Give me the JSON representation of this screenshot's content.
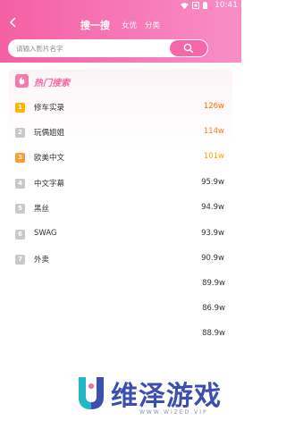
{
  "status": {
    "time": "10:41",
    "icons": [
      "wifi-icon",
      "battery-saver-icon",
      "battery-icon"
    ]
  },
  "header": {
    "back_icon": "chevron-left-icon",
    "tabs": [
      {
        "label": "搜一搜",
        "active": true
      },
      {
        "label": "女优",
        "active": false
      },
      {
        "label": "分类",
        "active": false
      }
    ]
  },
  "search": {
    "placeholder": "请输入影片名字",
    "button_icon": "search-icon"
  },
  "hot": {
    "title": "热门搜索",
    "items": [
      {
        "rank": "1",
        "name": "修车实录",
        "count": "126w"
      },
      {
        "rank": "2",
        "name": "玩偶姐姐",
        "count": "114w"
      },
      {
        "rank": "3",
        "name": "欧美中文",
        "count": "101w"
      },
      {
        "rank": "4",
        "name": "中文字幕",
        "count": "95.9w"
      },
      {
        "rank": "5",
        "name": "黑丝",
        "count": "94.9w"
      },
      {
        "rank": "6",
        "name": "SWAG",
        "count": "93.9w"
      },
      {
        "rank": "7",
        "name": "外卖",
        "count": "90.9w"
      }
    ],
    "extra_counts": [
      "89.9w",
      "86.9w",
      "88.9w"
    ]
  },
  "watermark": {
    "text": "维泽游戏",
    "sub": "WWW.WIZED.VIP"
  },
  "colors": {
    "brand_pink": "#f566ab",
    "hot_orange": "#ff6a00"
  }
}
